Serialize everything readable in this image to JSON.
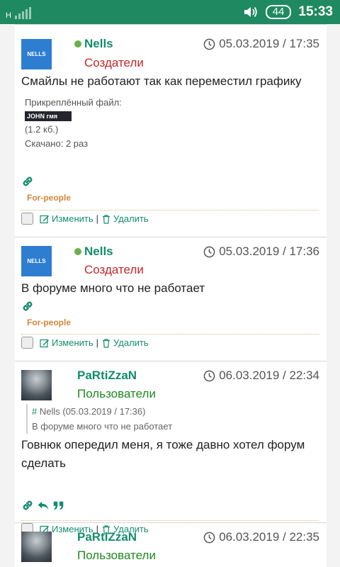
{
  "status_bar": {
    "network": "H",
    "battery": "44",
    "time": "15:33"
  },
  "posts": [
    {
      "author": "Nells",
      "avatar_text": "NELLS",
      "role": "Создатели",
      "date": "05.03.2019 / 17:35",
      "message": "Смайлы не работают так как переместил графику",
      "attachment": {
        "label": "Прикреплённый файл:",
        "image_text": "JOHN гмя",
        "size": "(1.2 кб.)",
        "downloads": "Скачано: 2 раз"
      },
      "signature": "For-people"
    },
    {
      "author": "Nells",
      "avatar_text": "NELLS",
      "role": "Создатели",
      "date": "05.03.2019 / 17:36",
      "message": "В форуме много что не работает",
      "signature": "For-people"
    },
    {
      "author": "PaRtiZzaN",
      "role": "Пользователи",
      "date": "06.03.2019 / 22:34",
      "quote": {
        "hash": "#",
        "header": "Nells (05.03.2019 / 17:36)",
        "text": "В форуме много что не работает"
      },
      "message_line1": "Говнюк опередил меня, я тоже давно хотел форум",
      "message_line2": "сделать"
    },
    {
      "author": "PaRtiZzaN",
      "role": "Пользователи",
      "date": "06.03.2019 / 22:35"
    }
  ],
  "actions": {
    "edit": "Изменить",
    "separator": "|",
    "delete": "Удалить"
  },
  "colors": {
    "status_bar": "#1f8a62",
    "username": "#138c6d",
    "role_creators": "#c0282b",
    "role_users": "#1e8a1e",
    "signature": "#d0873a"
  }
}
